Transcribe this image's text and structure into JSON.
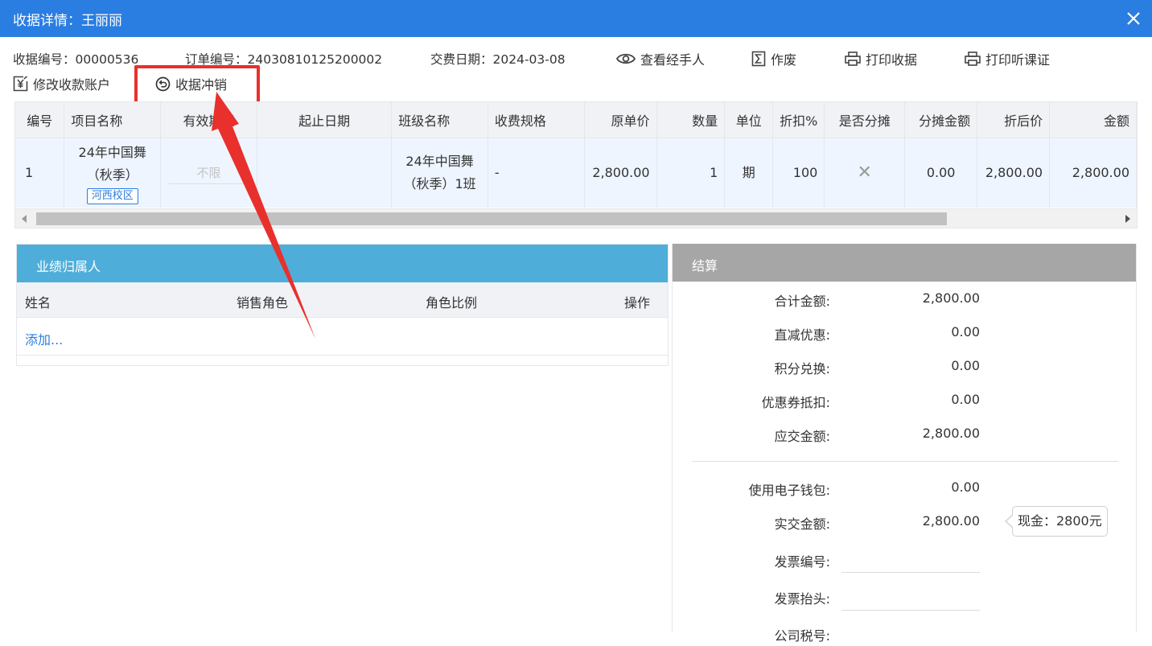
{
  "dialog": {
    "title": "收据详情：王丽丽"
  },
  "info": {
    "receipt_no": "收据编号：00000536",
    "order_no": "订单编号：24030810125200002",
    "pay_date": "交费日期：2024-03-08"
  },
  "actions": {
    "view_handler": "查看经手人",
    "void": "作废",
    "print_receipt": "打印收据",
    "print_audit_cert": "打印听课证",
    "edit_account": "修改收款账户",
    "reverse": "收据冲销"
  },
  "items_table": {
    "headers": [
      "编号",
      "项目名称",
      "有效期至",
      "起止日期",
      "班级名称",
      "收费规格",
      "原单价",
      "数量",
      "单位",
      "折扣%",
      "是否分摊",
      "分摊金额",
      "折后价",
      "金额"
    ],
    "rows": [
      {
        "no": "1",
        "item_name_line1": "24年中国舞",
        "item_name_line2": "（秋季）",
        "campus": "河西校区",
        "valid_until": "不限",
        "date_range": "",
        "class_line1": "24年中国舞",
        "class_line2": "（秋季）1班",
        "spec": "-",
        "unit_price": "2,800.00",
        "quantity": "1",
        "unit": "期",
        "discount": "100",
        "apportion": "✕",
        "apportion_amount": "0.00",
        "discounted_price": "2,800.00",
        "amount": "2,800.00"
      }
    ]
  },
  "performance": {
    "title": "业绩归属人",
    "col_name": "姓名",
    "col_role": "销售角色",
    "col_ratio": "角色比例",
    "col_op": "操作",
    "add": "添加..."
  },
  "settlement": {
    "title": "结算",
    "total_label": "合计金额:",
    "total": "2,800.00",
    "direct_label": "直减优惠:",
    "direct": "0.00",
    "points_label": "积分兑换:",
    "points": "0.00",
    "coupon_label": "优惠券抵扣:",
    "coupon": "0.00",
    "due_label": "应交金额:",
    "due": "2,800.00",
    "wallet_label": "使用电子钱包:",
    "wallet": "0.00",
    "paid_label": "实交金额:",
    "paid": "2,800.00",
    "paid_tip": "现金：2800元",
    "invoice_no_label": "发票编号:",
    "invoice_title_label": "发票抬头:",
    "company_no_label": "公司税号:"
  },
  "colors": {
    "titlebar": "#2a7de1",
    "performance_head": "#4eaed9",
    "settlement_head": "#a6a6a6",
    "annotation_red": "#e8302c",
    "row_bg": "#eef5ff"
  }
}
